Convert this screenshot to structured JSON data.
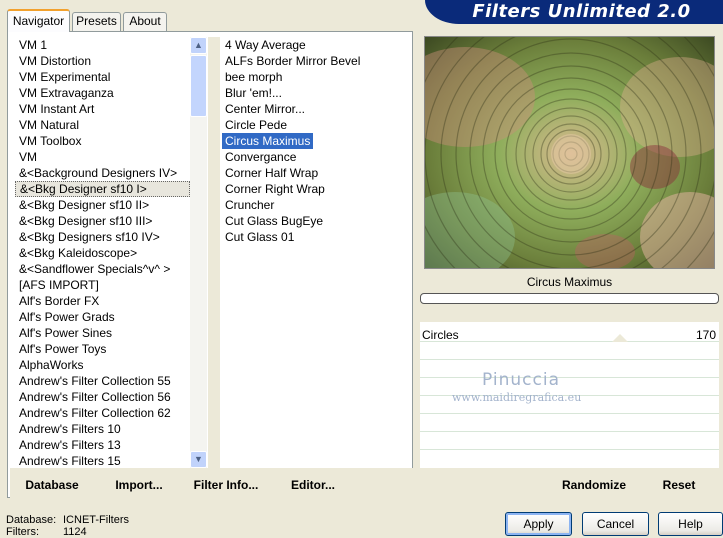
{
  "window": {
    "title": "Filters Unlimited 2.0"
  },
  "tabs": [
    {
      "label": "Navigator",
      "active": true
    },
    {
      "label": "Presets",
      "active": false
    },
    {
      "label": "About",
      "active": false
    }
  ],
  "categories": {
    "items": [
      "VM 1",
      "VM Distortion",
      "VM Experimental",
      "VM Extravaganza",
      "VM Instant Art",
      "VM Natural",
      "VM Toolbox",
      "VM",
      "&<Background Designers IV>",
      "&<Bkg Designer sf10 I>",
      "&<Bkg Designer sf10 II>",
      "&<Bkg Designer sf10 III>",
      "&<Bkg Designers sf10 IV>",
      "&<Bkg Kaleidoscope>",
      "&<Sandflower Specials^v^ >",
      "[AFS IMPORT]",
      "Alf's Border FX",
      "Alf's Power Grads",
      "Alf's Power Sines",
      "Alf's Power Toys",
      "AlphaWorks",
      "Andrew's Filter Collection 55",
      "Andrew's Filter Collection 56",
      "Andrew's Filter Collection 62",
      "Andrew's Filters 10",
      "Andrew's Filters 13",
      "Andrew's Filters 15"
    ],
    "highlighted": "&<Bkg Designer sf10 I>"
  },
  "filters": {
    "items": [
      "4 Way Average",
      "ALFs Border Mirror Bevel",
      "bee morph",
      "Blur 'em!...",
      "Center Mirror...",
      "Circle Pede",
      "Circus Maximus",
      "Convergance",
      "Corner Half Wrap",
      "Corner Right Wrap",
      "Cruncher",
      "Cut Glass  BugEye",
      "Cut Glass 01"
    ],
    "selected": "Circus Maximus"
  },
  "left_buttons": {
    "database": "Database",
    "import": "Import...",
    "filter_info": "Filter Info...",
    "editor": "Editor..."
  },
  "preview": {
    "filter_name": "Circus Maximus"
  },
  "param": {
    "label": "Circles",
    "value": "170",
    "level": 0.67
  },
  "watermark": {
    "line1": "Pinuccia",
    "line2": "www.maidiregrafica.eu"
  },
  "right_buttons": {
    "randomize": "Randomize",
    "reset": "Reset"
  },
  "status": {
    "database_label": "Database:",
    "database_value": "ICNET-Filters",
    "filters_label": "Filters:",
    "filters_value": "1124"
  },
  "dialog_buttons": {
    "apply": "Apply",
    "cancel": "Cancel",
    "help": "Help"
  },
  "colors": {
    "banner": "#0a2a7a",
    "selection": "#316ac5",
    "tab_accent": "#f2a12d"
  }
}
